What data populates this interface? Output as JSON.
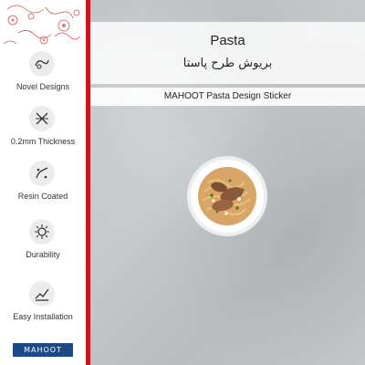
{
  "header": {
    "title_en": "Pasta",
    "title_fa": "بریوش طرح پاستا"
  },
  "caption": "MAHOOT Pasta Design Sticker",
  "features": [
    {
      "label": "Novel Designs",
      "icon": "pattern-icon"
    },
    {
      "label": "0.2mm Thickness",
      "icon": "thickness-icon"
    },
    {
      "label": "Resin Coated",
      "icon": "resin-icon"
    },
    {
      "label": "Durability",
      "icon": "durability-icon"
    },
    {
      "label": "Easy Installation",
      "icon": "installation-icon"
    }
  ],
  "brand": {
    "logo_text": "MAHOOT"
  },
  "colors": {
    "accent_red": "#c8161d",
    "brand_blue": "#1b4a86",
    "stone_gray": "#c2c5c7"
  }
}
